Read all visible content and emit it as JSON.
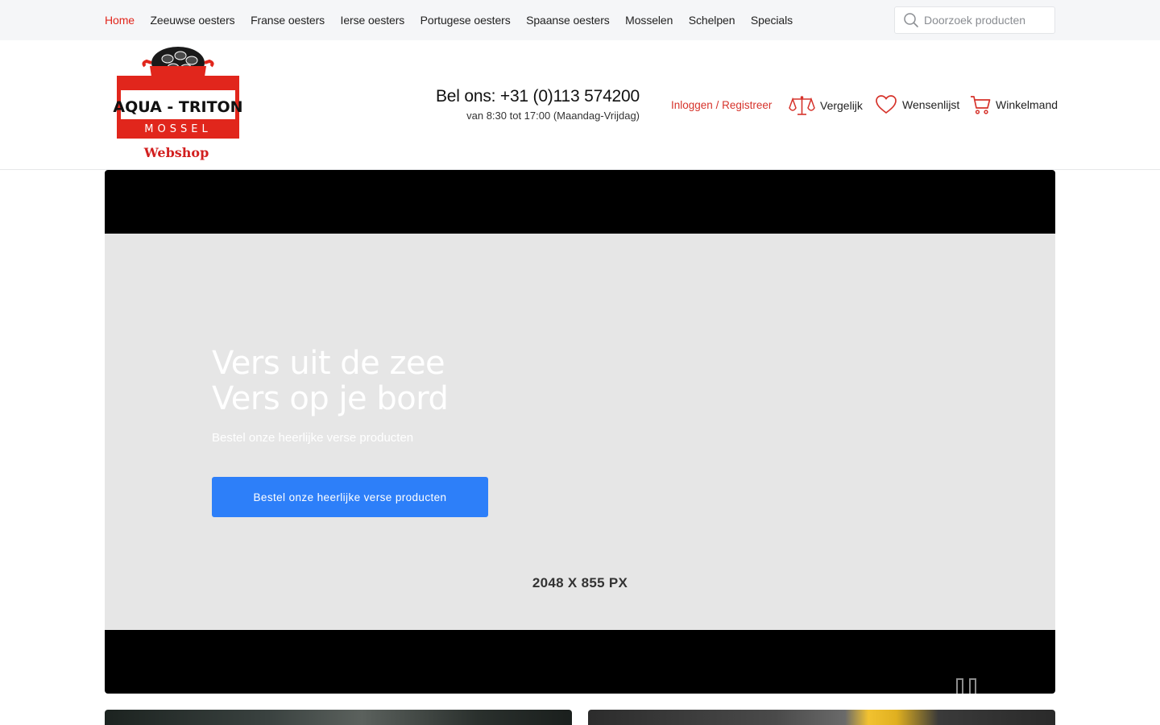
{
  "topnav": {
    "items": [
      {
        "label": "Home",
        "active": true
      },
      {
        "label": "Zeeuwse oesters"
      },
      {
        "label": "Franse oesters"
      },
      {
        "label": "Ierse oesters"
      },
      {
        "label": "Portugese oesters"
      },
      {
        "label": "Spaanse oesters"
      },
      {
        "label": "Mosselen"
      },
      {
        "label": "Schelpen"
      },
      {
        "label": "Specials"
      }
    ],
    "search_placeholder": "Doorzoek producten"
  },
  "header": {
    "logo": {
      "line1": "AQUA - TRITON",
      "line2": "MOSSEL",
      "line3": "Webshop"
    },
    "phone": "Bel ons: +31 (0)113 574200",
    "hours": "van 8:30 tot 17:00 (Maandag-Vrijdag)",
    "login": "Inloggen",
    "separator": " / ",
    "register": "Registreer",
    "compare": "Vergelijk",
    "wishlist": "Wensenlijst",
    "cart": "Winkelmand"
  },
  "hero": {
    "title_line1": "Vers uit de zee",
    "title_line2": "Vers op je bord",
    "subtitle": "Bestel onze heerlijke verse producten",
    "button": "Bestel onze heerlijke verse producten",
    "placeholder_size": "2048 X 855 PX"
  },
  "colors": {
    "accent_red": "#e1261c",
    "button_blue": "#2d7ff9"
  }
}
